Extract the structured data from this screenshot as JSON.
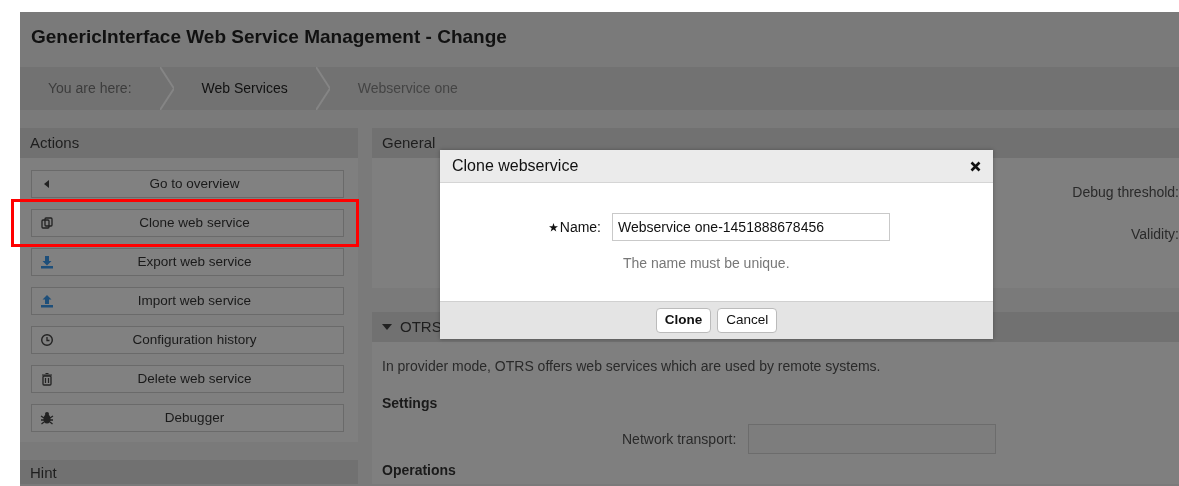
{
  "page_title": "GenericInterface Web Service Management - Change",
  "breadcrumb": [
    {
      "label": "You are here:",
      "kind": "prefix"
    },
    {
      "label": "Web Services",
      "kind": "link"
    },
    {
      "label": "Webservice one",
      "kind": "current"
    }
  ],
  "actions": {
    "title": "Actions",
    "items": [
      {
        "label": "Go to overview",
        "highlighted": false
      },
      {
        "label": "Clone web service",
        "highlighted": true
      },
      {
        "label": "Export web service",
        "highlighted": false
      },
      {
        "label": "Import web service",
        "highlighted": false
      },
      {
        "label": "Configuration history",
        "highlighted": false
      },
      {
        "label": "Delete web service",
        "highlighted": false
      },
      {
        "label": "Debugger",
        "highlighted": false
      }
    ]
  },
  "hint": {
    "title": "Hint"
  },
  "general": {
    "title": "General",
    "fields": [
      {
        "label": "Debug threshold:"
      },
      {
        "label": "Validity:"
      }
    ]
  },
  "provider": {
    "title": "OTRS",
    "expanded": true,
    "description": "In provider mode, OTRS offers web services which are used by remote systems.",
    "settings_title": "Settings",
    "fields": [
      {
        "label": "Network transport:"
      }
    ],
    "operations_title": "Operations"
  },
  "dialog": {
    "title": "Clone webservice",
    "field": {
      "label": "Name:",
      "required": true,
      "value": "Webservice one-1451888678456",
      "hint": "The name must be unique."
    },
    "buttons": [
      {
        "label": "Clone",
        "primary": true
      },
      {
        "label": "Cancel",
        "primary": false
      }
    ]
  }
}
